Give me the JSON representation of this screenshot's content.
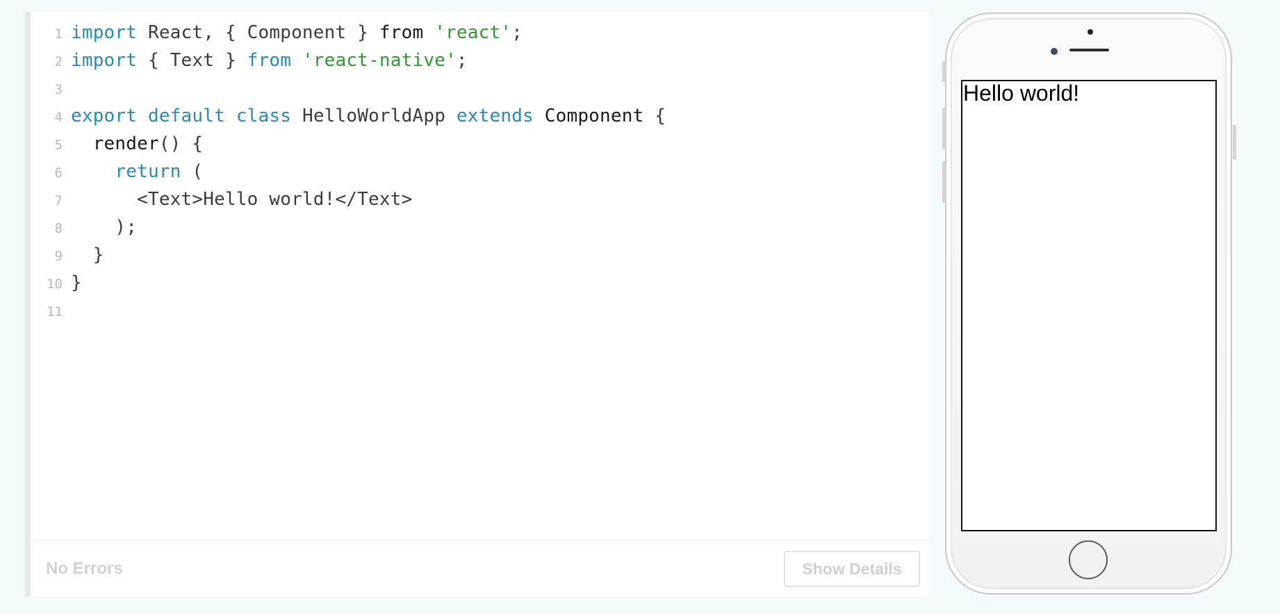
{
  "editor": {
    "lines": [
      {
        "number": "1",
        "tokens": [
          {
            "t": "import",
            "c": "kw"
          },
          {
            "t": " React, { Component } ",
            "c": "plain"
          },
          {
            "t": "from",
            "c": "dark"
          },
          {
            "t": " ",
            "c": "plain"
          },
          {
            "t": "'react'",
            "c": "str"
          },
          {
            "t": ";",
            "c": "plain"
          }
        ]
      },
      {
        "number": "2",
        "tokens": [
          {
            "t": "import",
            "c": "kw"
          },
          {
            "t": " { Text } ",
            "c": "plain"
          },
          {
            "t": "from",
            "c": "kw"
          },
          {
            "t": " ",
            "c": "plain"
          },
          {
            "t": "'react-native'",
            "c": "str"
          },
          {
            "t": ";",
            "c": "plain"
          }
        ]
      },
      {
        "number": "3",
        "tokens": []
      },
      {
        "number": "4",
        "tokens": [
          {
            "t": "export",
            "c": "kw"
          },
          {
            "t": " ",
            "c": "plain"
          },
          {
            "t": "default",
            "c": "kw"
          },
          {
            "t": " ",
            "c": "plain"
          },
          {
            "t": "class",
            "c": "kw"
          },
          {
            "t": " HelloWorldApp ",
            "c": "plain"
          },
          {
            "t": "extends",
            "c": "kw"
          },
          {
            "t": " ",
            "c": "plain"
          },
          {
            "t": "Component",
            "c": "dark"
          },
          {
            "t": " {",
            "c": "plain"
          }
        ]
      },
      {
        "number": "5",
        "tokens": [
          {
            "t": "  render",
            "c": "dark"
          },
          {
            "t": "() {",
            "c": "plain"
          }
        ]
      },
      {
        "number": "6",
        "tokens": [
          {
            "t": "    ",
            "c": "plain"
          },
          {
            "t": "return",
            "c": "kw"
          },
          {
            "t": " (",
            "c": "plain"
          }
        ]
      },
      {
        "number": "7",
        "tokens": [
          {
            "t": "      <Text>Hello world!</Text>",
            "c": "plain"
          }
        ]
      },
      {
        "number": "8",
        "tokens": [
          {
            "t": "    );",
            "c": "plain"
          }
        ]
      },
      {
        "number": "9",
        "tokens": [
          {
            "t": "  }",
            "c": "plain"
          }
        ]
      },
      {
        "number": "10",
        "tokens": [
          {
            "t": "}",
            "c": "plain"
          }
        ]
      },
      {
        "number": "11",
        "tokens": []
      }
    ]
  },
  "status": {
    "text": "No Errors",
    "details_label": "Show Details"
  },
  "preview": {
    "screen_text": "Hello world!"
  },
  "colors": {
    "keyword": "#268bb5",
    "string": "#2e9a2e",
    "background": "#f4f9fc"
  }
}
